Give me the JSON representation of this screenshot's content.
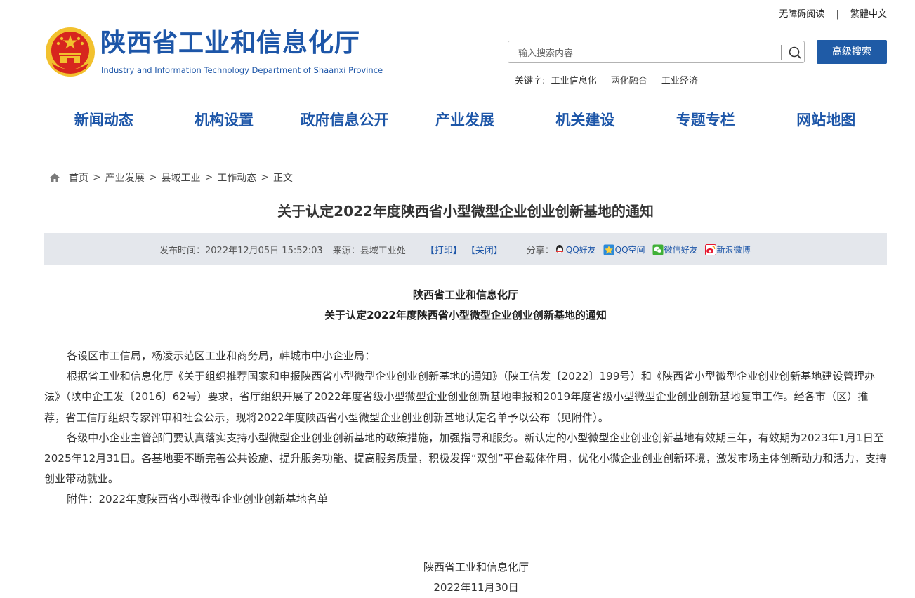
{
  "top_links": {
    "accessible": "无障碍阅读",
    "separator": "|",
    "traditional": "繁體中文"
  },
  "header": {
    "title": "陕西省工业和信息化厅",
    "subtitle": "Industry and Information Technology Department of Shaanxi Province"
  },
  "search": {
    "placeholder": "输入搜索内容",
    "advanced_label": "高级搜索"
  },
  "keywords": {
    "label": "关键字:",
    "items": [
      "工业信息化",
      "两化融合",
      "工业经济"
    ]
  },
  "nav": [
    "新闻动态",
    "机构设置",
    "政府信息公开",
    "产业发展",
    "机关建设",
    "专题专栏",
    "网站地图"
  ],
  "breadcrumb": {
    "items": [
      "首页",
      "产业发展",
      "县域工业",
      "工作动态",
      "正文"
    ],
    "separator": ">"
  },
  "article": {
    "title": "关于认定2022年度陕西省小型微型企业创业创新基地的通知",
    "meta": {
      "publish_time": "发布时间：2022年12月05日 15:52:03",
      "source": "来源：县域工业处",
      "print": "【打印】",
      "close": "【关闭】",
      "share_label": "分享：",
      "share": [
        "QQ好友",
        "QQ空间",
        "微信好友",
        "新浪微博"
      ]
    },
    "doc_org": "陕西省工业和信息化厅",
    "doc_title": "关于认定2022年度陕西省小型微型企业创业创新基地的通知",
    "paragraphs": [
      "各设区市工信局，杨凌示范区工业和商务局，韩城市中小企业局：",
      "根据省工业和信息化厅《关于组织推荐国家和申报陕西省小型微型企业创业创新基地的通知》（陕工信发〔2022〕199号）和《陕西省小型微型企业创业创新基地建设管理办法》（陕中企工发〔2016〕62号）要求，省厅组织开展了2022年度省级小型微型企业创业创新基地申报和2019年度省级小型微型企业创业创新基地复审工作。经各市（区）推荐，省工信厅组织专家评审和社会公示，现将2022年度陕西省小型微型企业创业创新基地认定名单予以公布（见附件）。",
      "各级中小企业主管部门要认真落实支持小型微型企业创业创新基地的政策措施，加强指导和服务。新认定的小型微型企业创业创新基地有效期三年，有效期为2023年1月1日至2025年12月31日。各基地要不断完善公共设施、提升服务功能、提高服务质量，积极发挥“双创”平台载体作用，优化小微企业创业创新环境，激发市场主体创新动力和活力，支持创业带动就业。",
      "附件：2022年度陕西省小型微型企业创业创新基地名单"
    ],
    "sign_org": "陕西省工业和信息化厅",
    "sign_date": "2022年11月30日"
  },
  "colors": {
    "brand_blue": "#1d56a8",
    "button_blue": "#1f5ba6",
    "infobar_bg": "#e4e7ec",
    "emblem_red": "#d7261e",
    "emblem_gold": "#f2c12e"
  }
}
